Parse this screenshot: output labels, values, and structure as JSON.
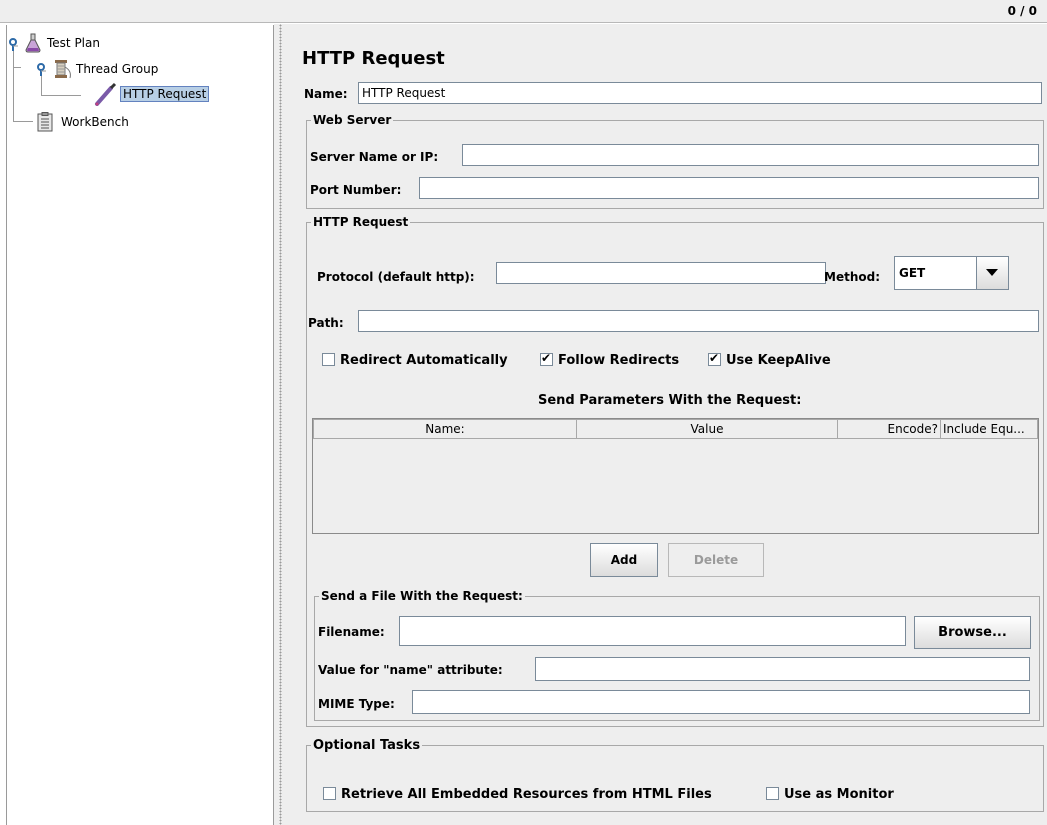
{
  "status": {
    "counter": "0 / 0"
  },
  "tree": {
    "nodes": [
      {
        "label": "Test Plan"
      },
      {
        "label": "Thread Group"
      },
      {
        "label": "HTTP Request"
      },
      {
        "label": "WorkBench"
      }
    ]
  },
  "panel": {
    "title": "HTTP Request",
    "name_label": "Name:",
    "name_value": "HTTP Request",
    "web_server": {
      "legend": "Web Server",
      "server_label": "Server Name or IP:",
      "server_value": "",
      "port_label": "Port Number:",
      "port_value": ""
    },
    "http_request": {
      "legend": "HTTP Request",
      "protocol_label": "Protocol (default http):",
      "protocol_value": "",
      "method_label": "Method:",
      "method_value": "GET",
      "path_label": "Path:",
      "path_value": "",
      "redirect_auto": {
        "label": "Redirect Automatically",
        "checked": false
      },
      "follow_redirects": {
        "label": "Follow Redirects",
        "checked": true
      },
      "keepalive": {
        "label": "Use KeepAlive",
        "checked": true
      },
      "params_title": "Send Parameters With the Request:",
      "columns": [
        "Name:",
        "Value",
        "Encode?",
        "Include Equ..."
      ],
      "add_label": "Add",
      "delete_label": "Delete"
    },
    "file": {
      "legend": "Send a File With the Request:",
      "filename_label": "Filename:",
      "filename_value": "",
      "browse_label": "Browse...",
      "name_attr_label": "Value for \"name\" attribute:",
      "name_attr_value": "",
      "mime_label": "MIME Type:",
      "mime_value": ""
    },
    "optional": {
      "legend": "Optional Tasks",
      "retrieve": {
        "label": "Retrieve All Embedded Resources from HTML Files",
        "checked": false
      },
      "monitor": {
        "label": "Use as Monitor",
        "checked": false
      }
    }
  }
}
